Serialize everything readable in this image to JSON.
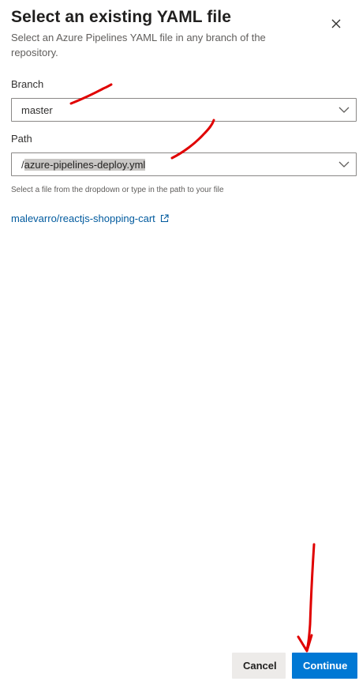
{
  "dialog": {
    "title": "Select an existing YAML file",
    "subtitle": "Select an Azure Pipelines YAML file in any branch of the repository.",
    "close_icon": "close-icon"
  },
  "branch": {
    "label": "Branch",
    "value": "master",
    "icon": "chevron-down-icon"
  },
  "path": {
    "label": "Path",
    "value_prefix": "/",
    "value_selected": "azure-pipelines-deploy.yml",
    "icon": "chevron-down-icon",
    "helper": "Select a file from the dropdown or type in the path to your file"
  },
  "repository": {
    "link_text": "malevarro/reactjs-shopping-cart",
    "icon": "external-link-icon"
  },
  "footer": {
    "cancel_label": "Cancel",
    "continue_label": "Continue"
  },
  "colors": {
    "accent": "#0078d4",
    "link": "#005a9e",
    "annotation": "#e00000"
  }
}
